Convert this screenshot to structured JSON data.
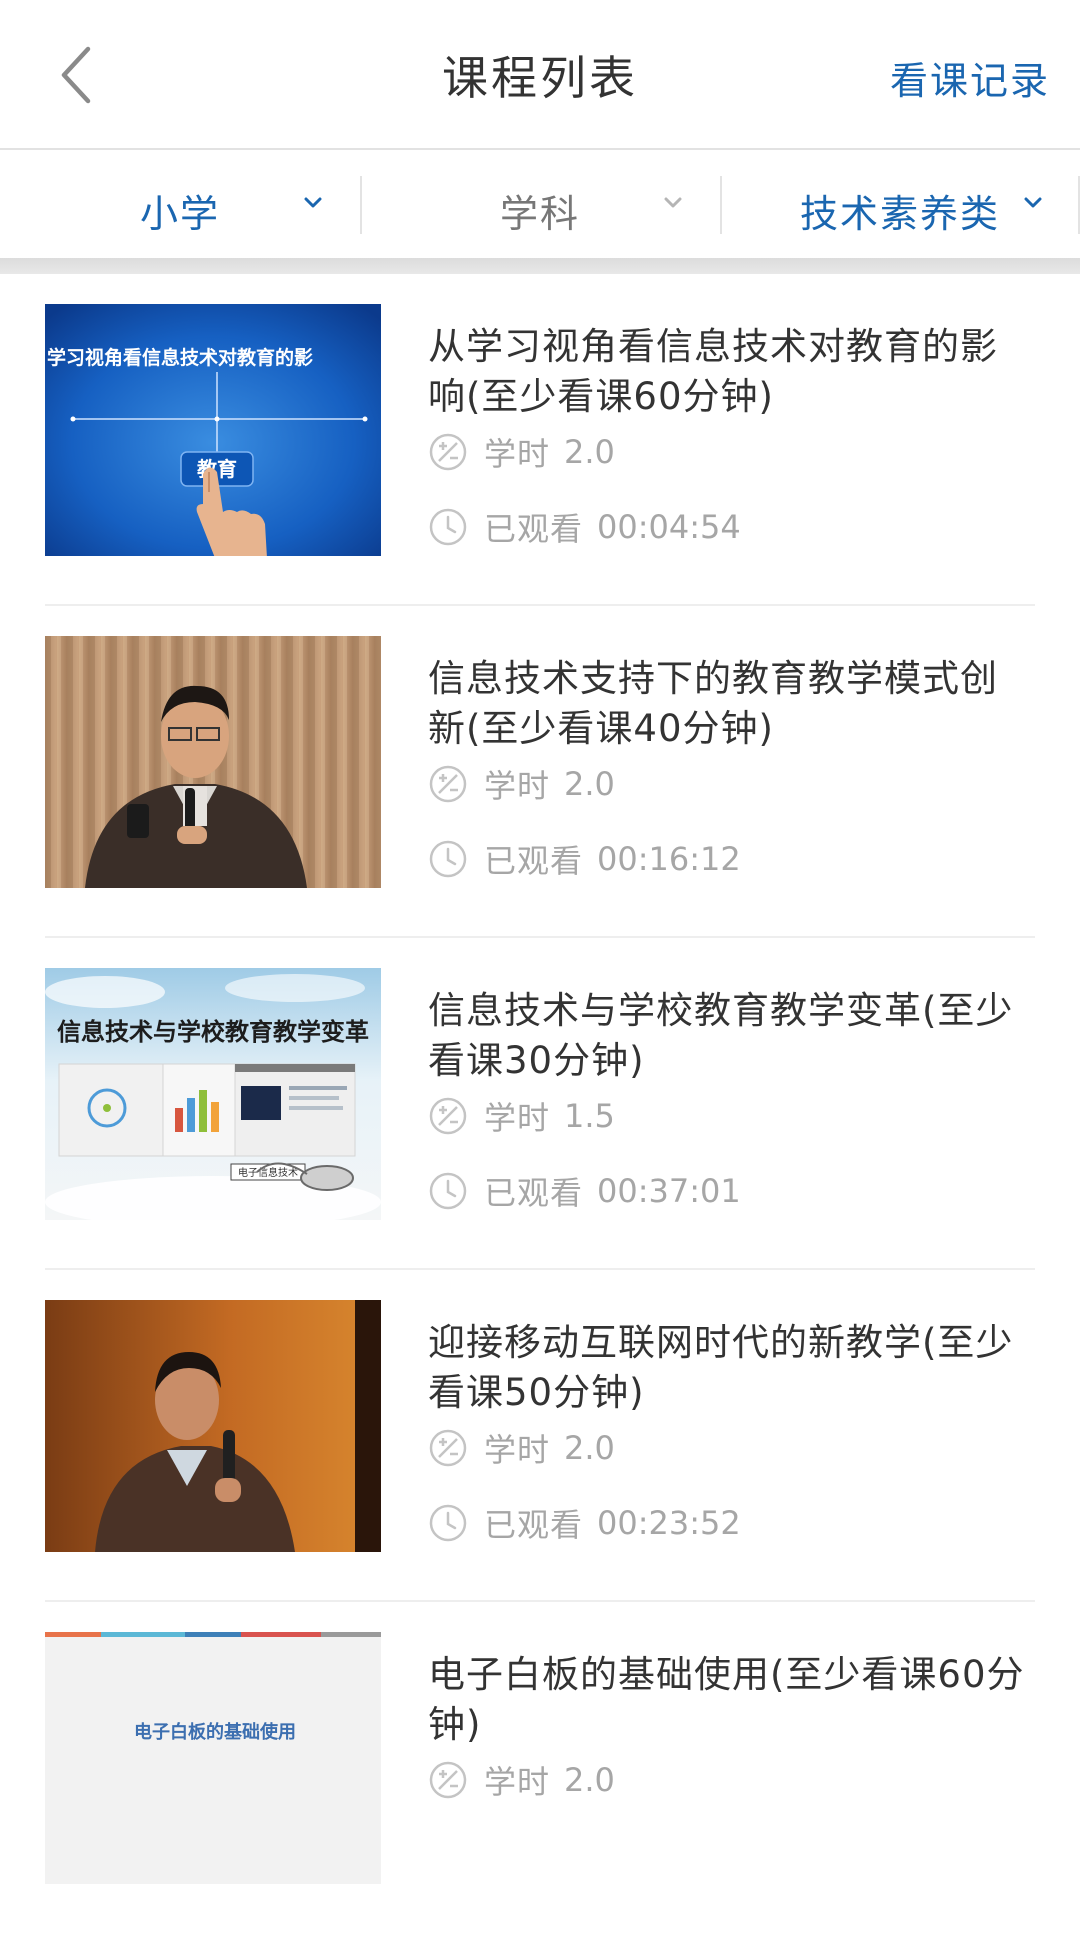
{
  "header": {
    "title": "课程列表",
    "history_link": "看课记录"
  },
  "filters": [
    {
      "label": "小学",
      "state": "active"
    },
    {
      "label": "学科",
      "state": "inactive"
    },
    {
      "label": "技术素养类",
      "state": "active"
    }
  ],
  "colors": {
    "accent": "#1a66b0",
    "muted_text": "#a6a6a6",
    "title_text": "#333333"
  },
  "labels": {
    "hours": "学时",
    "watched": "已观看"
  },
  "courses": [
    {
      "title": "从学习视角看信息技术对教育的影响(至少看课60分钟)",
      "hours": "2.0",
      "watched": "00:04:54",
      "thumb_text": "学习视角看信息技术对教育的影",
      "thumb_button": "教育"
    },
    {
      "title": "信息技术支持下的教育教学模式创新(至少看课40分钟)",
      "hours": "2.0",
      "watched": "00:16:12"
    },
    {
      "title": "信息技术与学校教育教学变革(至少看课30分钟)",
      "hours": "1.5",
      "watched": "00:37:01",
      "thumb_text": "信息技术与学校教育教学变革",
      "thumb_caption": "电子信息技术"
    },
    {
      "title": "迎接移动互联网时代的新教学(至少看课50分钟)",
      "hours": "2.0",
      "watched": "00:23:52"
    },
    {
      "title": "电子白板的基础使用(至少看课60分钟)",
      "hours": "2.0",
      "thumb_text": "电子白板的基础使用"
    }
  ]
}
